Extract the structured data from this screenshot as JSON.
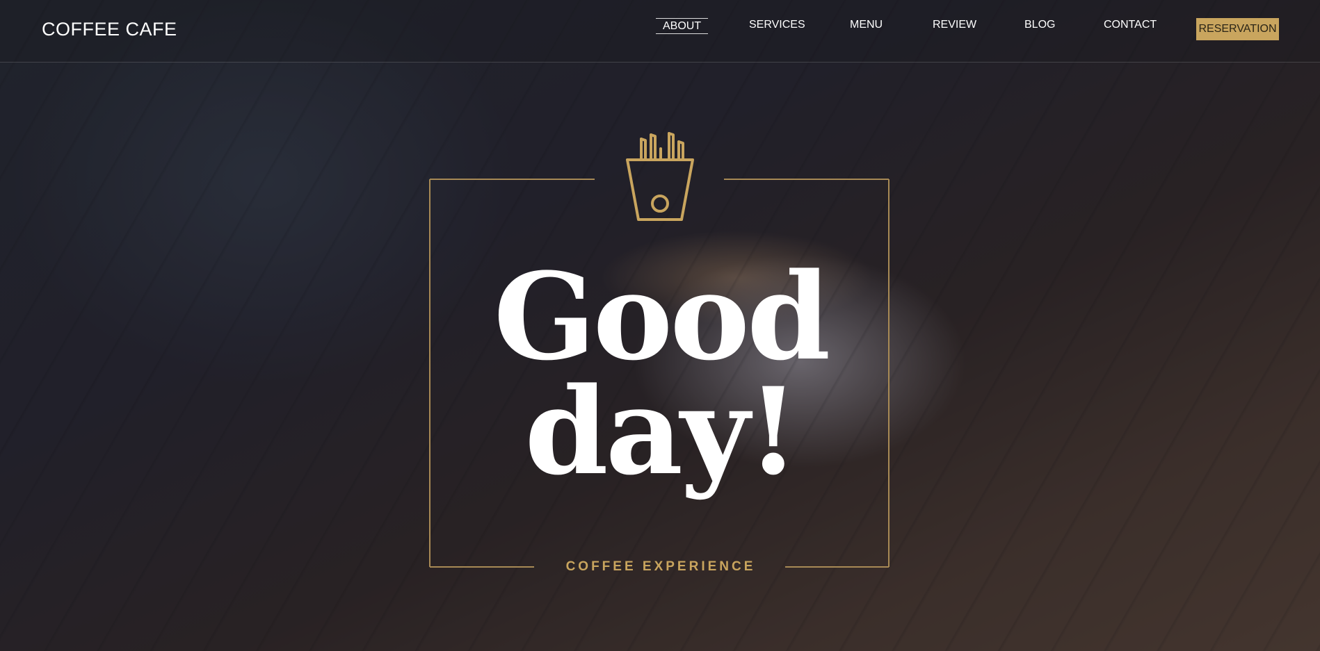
{
  "brand": {
    "name": "COFFEE CAFE"
  },
  "nav": {
    "items": [
      {
        "label": "ABOUT",
        "active": true
      },
      {
        "label": "SERVICES"
      },
      {
        "label": "MENU"
      },
      {
        "label": "REVIEW"
      },
      {
        "label": "BLOG"
      },
      {
        "label": "CONTACT"
      }
    ],
    "cta_label": "RESERVATION"
  },
  "hero": {
    "icon": "fries-box-icon",
    "headline_line1": "Good",
    "headline_line2": "day!",
    "tagline": "COFFEE EXPERIENCE"
  },
  "colors": {
    "accent": "#c9a55e",
    "text": "#ffffff",
    "frame": "#a88a55"
  }
}
